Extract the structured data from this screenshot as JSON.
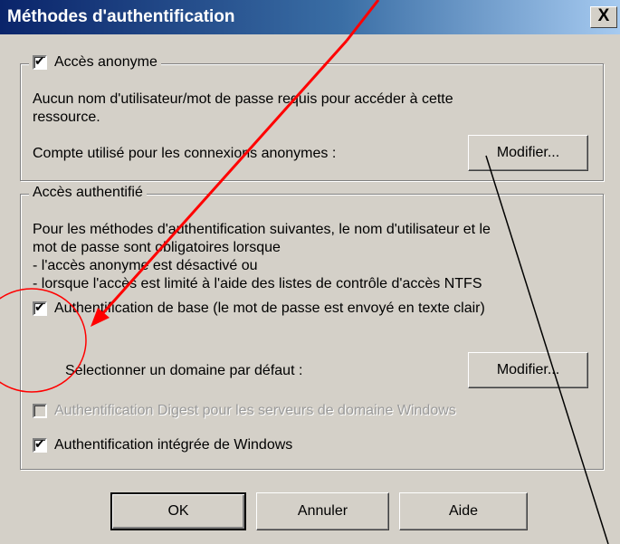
{
  "window": {
    "title": "Méthodes d'authentification",
    "close_label": "X"
  },
  "anonymous": {
    "checkbox_label": "Accès anonyme",
    "checked": true,
    "description_line1": "Aucun nom d'utilisateur/mot de passe requis pour accéder à cette",
    "description_line2": "ressource.",
    "account_label": "Compte utilisé pour les connexions anonymes :",
    "modify_button": "Modifier..."
  },
  "authenticated": {
    "group_label": "Accès authentifié",
    "description_lines": [
      "Pour les méthodes d'authentification suivantes, le nom d'utilisateur et le",
      "mot de passe sont obligatoires lorsque",
      "- l'accès anonyme est désactivé ou",
      "- lorsque l'accès est limité à l'aide des listes de contrôle d'accès NTFS"
    ],
    "basic_auth_label": "Authentification de base (le mot de passe est envoyé en texte clair)",
    "basic_auth_checked": true,
    "default_domain_label": "Sélectionner un domaine par défaut :",
    "domain_modify_button": "Modifier...",
    "digest_label": "Authentification Digest pour les serveurs de domaine Windows",
    "digest_checked": false,
    "integrated_label": "Authentification intégrée de Windows",
    "integrated_checked": true
  },
  "buttons": {
    "ok": "OK",
    "cancel": "Annuler",
    "help": "Aide"
  },
  "colors": {
    "annotation_red": "#ff0000",
    "annotation_black": "#000000",
    "titlebar": "#0a246a",
    "dialog_bg": "#d4d0c8"
  }
}
